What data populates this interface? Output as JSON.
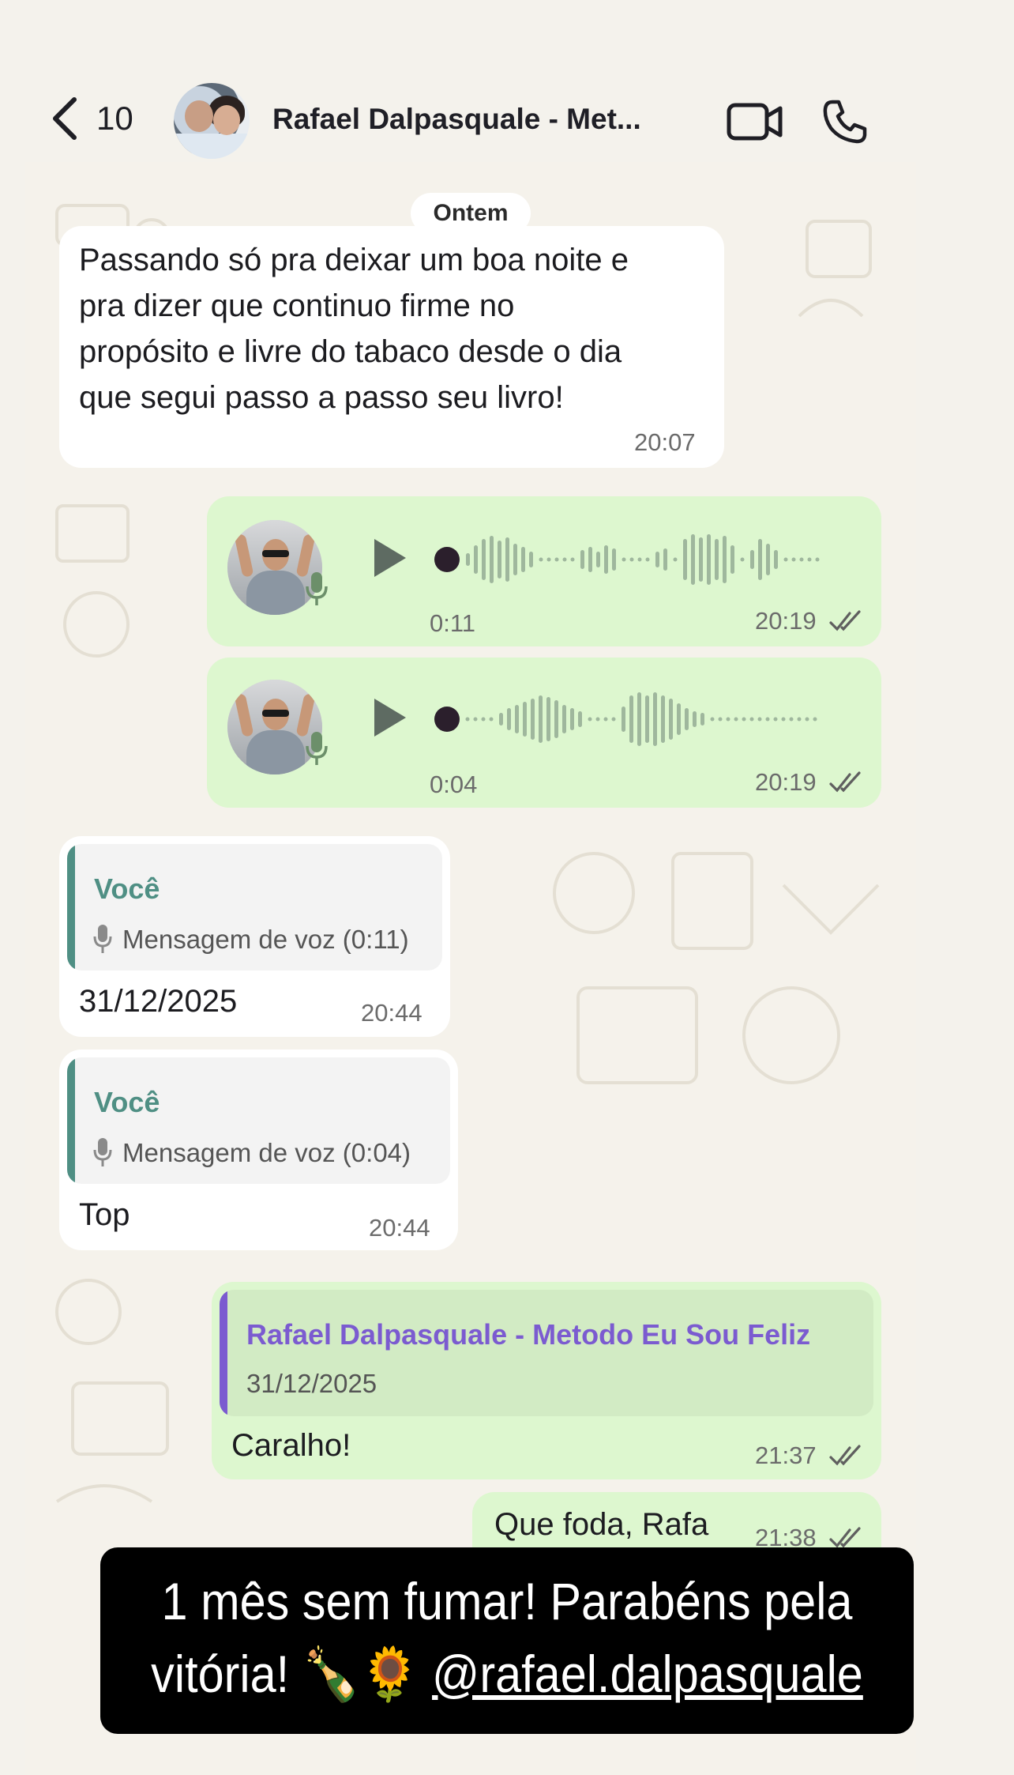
{
  "header": {
    "back_count": "10",
    "contact_name": "Rafael Dalpasquale - Met...",
    "icons": [
      "chevron-left-icon",
      "video-call-icon",
      "phone-call-icon"
    ]
  },
  "date_chip": "Ontem",
  "messages": [
    {
      "direction": "incoming",
      "type": "text",
      "lines": [
        "Passando só pra deixar um boa noite e",
        "pra dizer que continuo firme no",
        "propósito e livre do tabaco desde o dia",
        "que segui passo a passo seu livro!"
      ],
      "time": "20:07"
    },
    {
      "direction": "outgoing",
      "type": "voice",
      "duration": "0:11",
      "time": "20:19",
      "status": "read"
    },
    {
      "direction": "outgoing",
      "type": "voice",
      "duration": "0:04",
      "time": "20:19",
      "status": "read"
    },
    {
      "direction": "incoming",
      "type": "reply",
      "quote_author": "Você",
      "quote_text": "Mensagem de voz (0:11)",
      "text": "31/12/2025",
      "time": "20:44"
    },
    {
      "direction": "incoming",
      "type": "reply",
      "quote_author": "Você",
      "quote_text": "Mensagem de voz (0:04)",
      "text": "Top",
      "time": "20:44"
    },
    {
      "direction": "outgoing",
      "type": "reply",
      "quote_author": "Rafael Dalpasquale - Metodo Eu Sou Feliz",
      "quote_text": "31/12/2025",
      "text": "Caralho!",
      "time": "21:37",
      "status": "read"
    },
    {
      "direction": "outgoing",
      "type": "text",
      "text": "Que foda, Rafa",
      "time": "21:38",
      "status": "read"
    }
  ],
  "caption": {
    "line1": "1 mês sem fumar! Parabéns pela",
    "line2_prefix": "vitória! 🍾🌻 ",
    "mention": "@rafael.dalpasquale"
  },
  "colors": {
    "outgoing_bubble": "#ddf7cf",
    "incoming_bubble": "#ffffff",
    "quote_you_accent": "#4f8f84",
    "quote_contact_accent": "#7b5bd0",
    "caption_bg": "#000000"
  }
}
